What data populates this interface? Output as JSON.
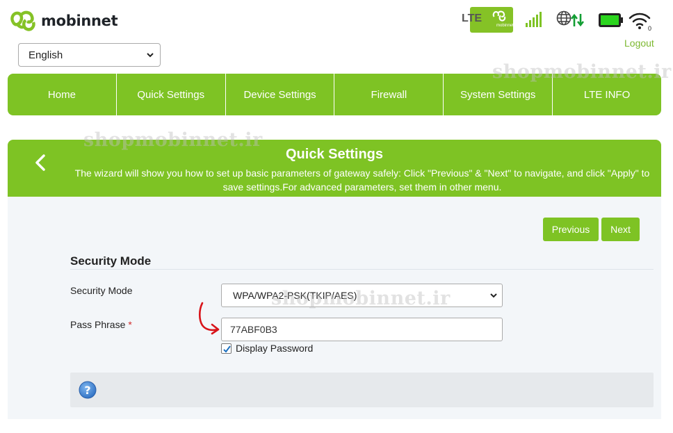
{
  "brand": {
    "name": "mobinnet",
    "accent": "#7ec324"
  },
  "language": {
    "selected": "English"
  },
  "status": {
    "network_type": "LTE",
    "sim_card_text": "mobinnet",
    "icons": [
      "lte-sim-icon",
      "signal-bars-icon",
      "globe-data-icon",
      "battery-icon",
      "wifi-icon"
    ],
    "wifi_clients": "0"
  },
  "header": {
    "logout_label": "Logout"
  },
  "nav": {
    "items": [
      {
        "label": "Home"
      },
      {
        "label": "Quick Settings"
      },
      {
        "label": "Device Settings"
      },
      {
        "label": "Firewall"
      },
      {
        "label": "System Settings"
      },
      {
        "label": "LTE INFO"
      }
    ]
  },
  "watermark": "shopmobinnet.ir",
  "wizard": {
    "title": "Quick Settings",
    "description": "The wizard will show you how to set up basic parameters of gateway safely: Click \"Previous\" & \"Next\" to navigate, and click \"Apply\" to save settings.For advanced parameters, set them in other menu.",
    "previous_label": "Previous",
    "next_label": "Next"
  },
  "form": {
    "section_title": "Security Mode",
    "security_mode_label": "Security Mode",
    "security_mode_value": "WPA/WPA2-PSK(TKIP/AES)",
    "pass_phrase_label": "Pass Phrase",
    "required_marker": "*",
    "pass_phrase_value": "77ABF0B3",
    "display_password_label": "Display Password",
    "display_password_checked": true
  }
}
